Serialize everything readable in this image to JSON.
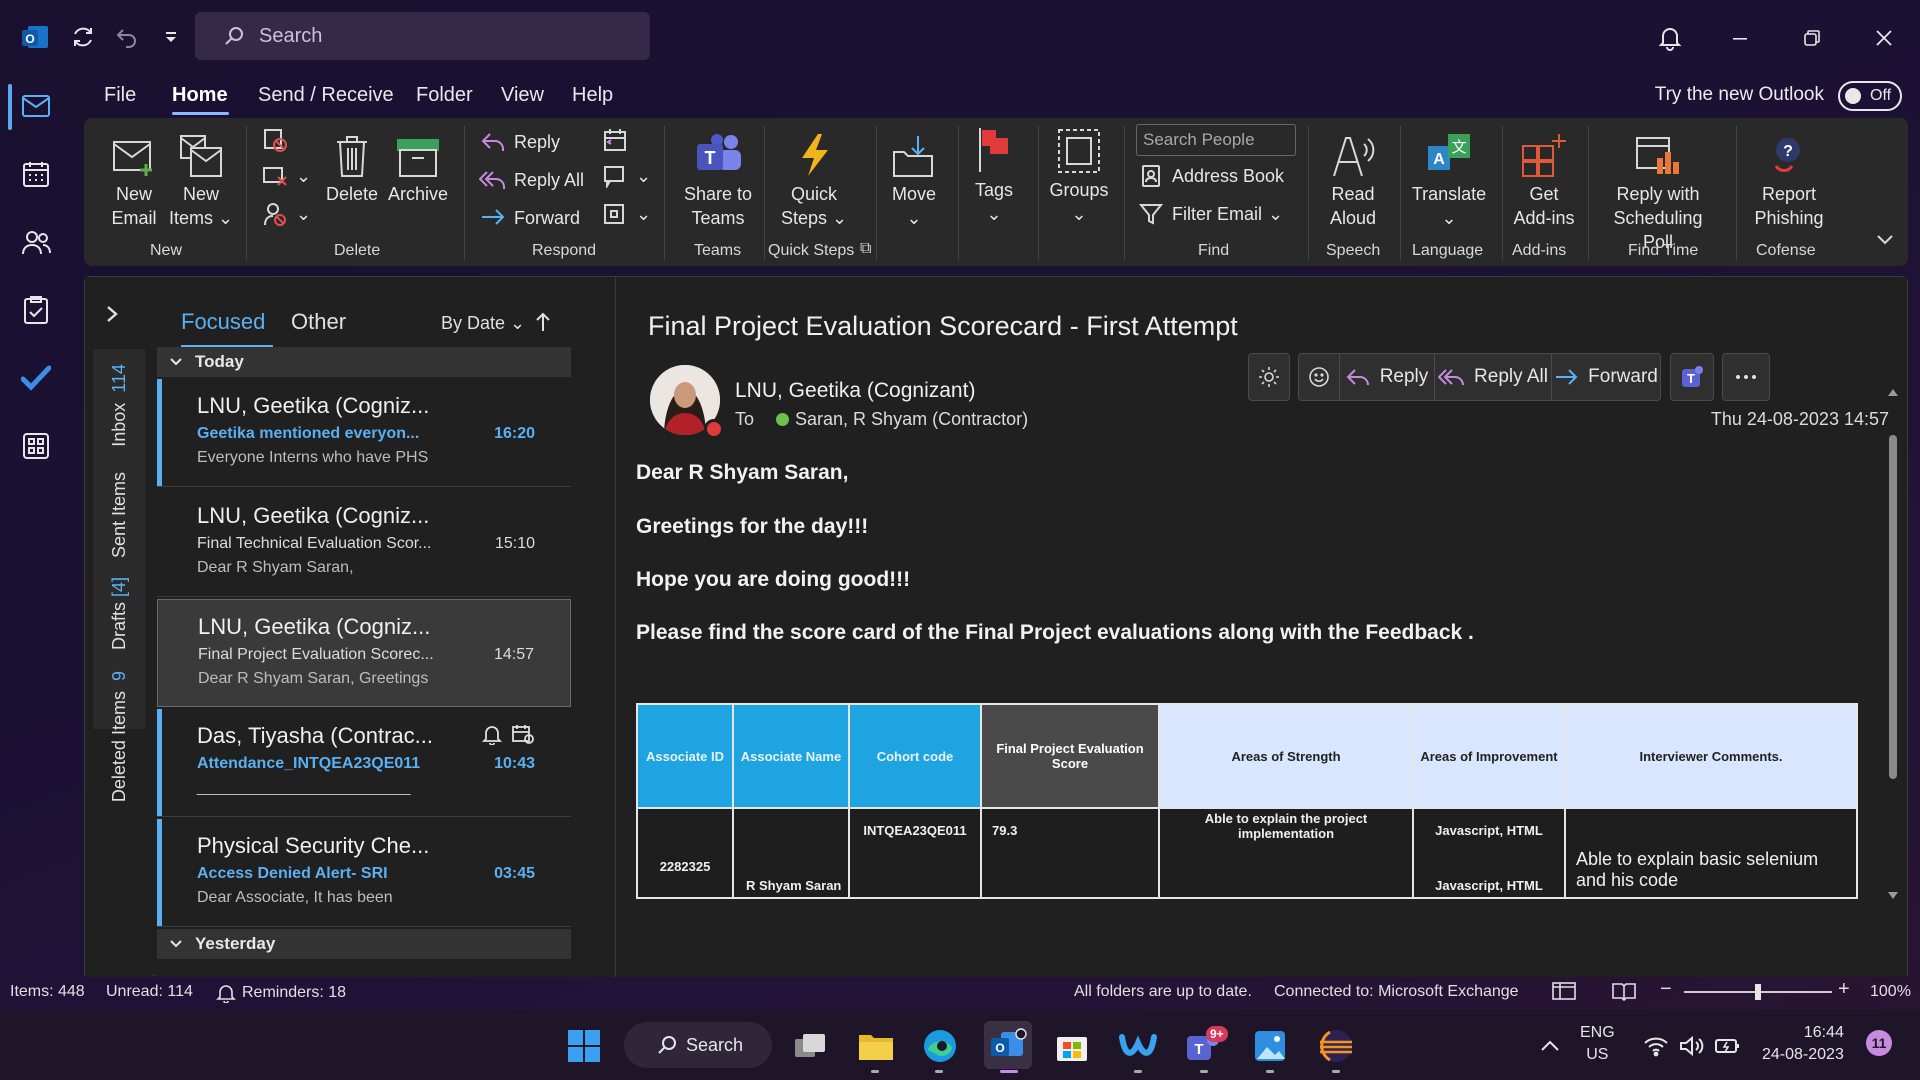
{
  "titlebar": {
    "search_placeholder": "Search"
  },
  "menu": {
    "tabs": [
      "File",
      "Home",
      "Send / Receive",
      "Folder",
      "View",
      "Help"
    ],
    "try_new": "Try the new Outlook",
    "toggle_label": "Off"
  },
  "ribbon": {
    "new_email": [
      "New",
      "Email"
    ],
    "new_items": [
      "New",
      "Items"
    ],
    "delete": "Delete",
    "archive": "Archive",
    "reply": "Reply",
    "reply_all": "Reply All",
    "forward": "Forward",
    "share_teams": [
      "Share to",
      "Teams"
    ],
    "quick_steps": [
      "Quick",
      "Steps"
    ],
    "move": "Move",
    "tags": "Tags",
    "groups": "Groups",
    "search_people_placeholder": "Search People",
    "address_book": "Address Book",
    "filter_email": "Filter Email",
    "read_aloud": [
      "Read",
      "Aloud"
    ],
    "translate": "Translate",
    "get_addins": [
      "Get",
      "Add-ins"
    ],
    "reply_poll": [
      "Reply with",
      "Scheduling Poll"
    ],
    "report_phishing": [
      "Report",
      "Phishing"
    ],
    "groups_labels": {
      "new": "New",
      "delete": "Delete",
      "respond": "Respond",
      "teams": "Teams",
      "quick_steps": "Quick Steps",
      "find": "Find",
      "speech": "Speech",
      "language": "Language",
      "addins": "Add-ins",
      "find_time": "Find Time",
      "cofense": "Cofense"
    }
  },
  "folders": [
    {
      "name": "Inbox",
      "count": "114"
    },
    {
      "name": "Sent Items",
      "count": ""
    },
    {
      "name": "Drafts",
      "count": "[4]"
    },
    {
      "name": "Deleted Items",
      "count": "9"
    }
  ],
  "list": {
    "focused": "Focused",
    "other": "Other",
    "sort": "By Date",
    "group_today": "Today",
    "group_yesterday": "Yesterday",
    "messages": [
      {
        "sender": "LNU, Geetika (Cogniz...",
        "subject": "Geetika mentioned everyon...",
        "preview": "Everyone  Interns who have PHS",
        "time": "16:20",
        "unread": true
      },
      {
        "sender": "LNU, Geetika (Cogniz...",
        "subject": "Final Technical Evaluation Scor...",
        "preview": "Dear   R Shyam Saran,",
        "time": "15:10",
        "unread": false
      },
      {
        "sender": "LNU, Geetika (Cogniz...",
        "subject": "Final Project Evaluation Scorec...",
        "preview": "Dear R Shyam Saran,  Greetings",
        "time": "14:57",
        "unread": false,
        "selected": true
      },
      {
        "sender": "Das, Tiyasha (Contrac...",
        "subject": "Attendance_INTQEA23QE011",
        "preview": "________________________",
        "time": "10:43",
        "unread": true
      },
      {
        "sender": "Physical Security Che...",
        "subject": "Access Denied Alert- SRI",
        "preview": "Dear Associate,  It has been",
        "time": "03:45",
        "unread": true
      }
    ]
  },
  "reading": {
    "subject": "Final Project Evaluation Scorecard - First Attempt",
    "from": "LNU, Geetika (Cognizant)",
    "to_label": "To",
    "to": "Saran, R Shyam (Contractor)",
    "datetime": "Thu 24-08-2023 14:57",
    "actions": {
      "reply": "Reply",
      "reply_all": "Reply All",
      "forward": "Forward"
    },
    "body": [
      "Dear R Shyam Saran,",
      "Greetings for the day!!!",
      "Hope you are doing good!!!",
      "Please find the score card of the Final Project evaluations along with the Feedback ."
    ],
    "table": {
      "headers": [
        "Associate ID",
        "Associate Name",
        "Cohort code",
        "Final Project Evaluation Score",
        "Areas of Strength",
        "Areas of Improvement",
        "Interviewer Comments."
      ],
      "row": {
        "associate_id": "2282325",
        "associate_name": "R Shyam Saran",
        "cohort_code": "INTQEA23QE011",
        "score": "79.3",
        "strength": "Able to explain the project implementation",
        "improvement_1": "Javascript, HTML",
        "improvement_2": "Javascript, HTML",
        "comments": "Able to explain basic selenium and his code"
      }
    }
  },
  "status": {
    "items": "Items: 448",
    "unread": "Unread: 114",
    "reminders": "Reminders: 18",
    "sync": "All folders are up to date.",
    "connected": "Connected to: Microsoft Exchange",
    "zoom": "100%",
    "zoom_level": 0.5
  },
  "taskbar": {
    "search": "Search",
    "lang1": "ENG",
    "lang2": "US",
    "time": "16:44",
    "date": "24-08-2023",
    "notifications": "11",
    "teams_badge": "9+"
  },
  "colors": {
    "accent": "#5ab0f2",
    "presence_busy": "#e03a3a",
    "presence_available": "#6cc24a",
    "table_blue": "#1ea4e0",
    "table_lavender": "#d8e6ff"
  }
}
